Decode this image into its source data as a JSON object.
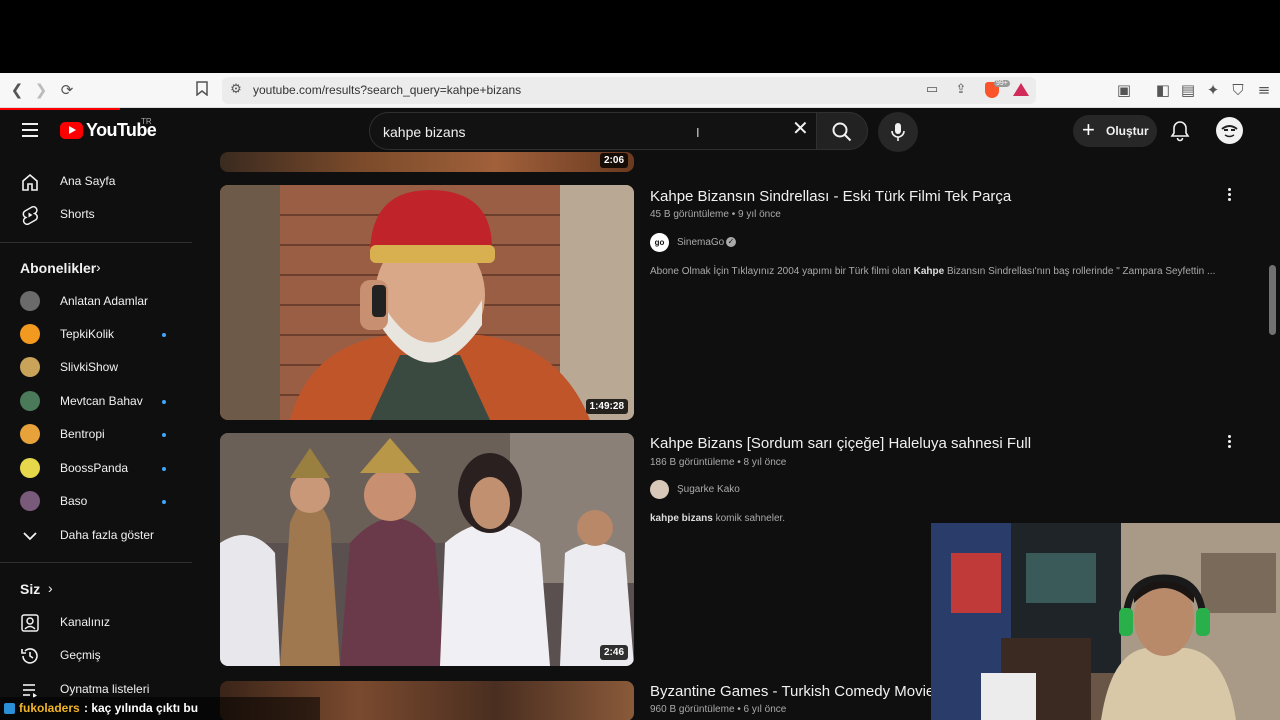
{
  "browser": {
    "url": "youtube.com/results?search_query=kahpe+bizans",
    "brave_badge": "99+"
  },
  "masthead": {
    "logo_text": "YouTube",
    "logo_region": "TR",
    "search_query": "kahpe bizans",
    "create_label": "Oluştur"
  },
  "sidebar": {
    "main": [
      {
        "label": "Ana Sayfa",
        "icon": "home-icon"
      },
      {
        "label": "Shorts",
        "icon": "shorts-icon"
      }
    ],
    "subscriptions_header": "Abonelikler",
    "subscriptions": [
      {
        "label": "Anlatan Adamlar",
        "dot": false,
        "color": "#6b6b6b"
      },
      {
        "label": "TepkiKolik",
        "dot": true,
        "color": "#f29a1f"
      },
      {
        "label": "SlivkiShow",
        "dot": false,
        "color": "#c9a35a"
      },
      {
        "label": "Mevtcan Bahav",
        "dot": true,
        "color": "#4a7a5a"
      },
      {
        "label": "Bentropi",
        "dot": true,
        "color": "#e8a23a"
      },
      {
        "label": "BoossPanda",
        "dot": true,
        "color": "#e6d84a"
      },
      {
        "label": "Baso",
        "dot": true,
        "color": "#7a5a7a"
      }
    ],
    "show_more": "Daha fazla göster",
    "you_header": "Siz",
    "you_items": [
      {
        "label": "Kanalınız",
        "icon": "your-channel-icon"
      },
      {
        "label": "Geçmiş",
        "icon": "history-icon"
      },
      {
        "label": "Oynatma listeleri",
        "icon": "playlists-icon"
      }
    ]
  },
  "results": [
    {
      "duration": "2:06"
    },
    {
      "title": "Kahpe Bizansın Sindrellası - Eski Türk Filmi Tek Parça",
      "meta": "45 B görüntüleme • 9 yıl önce",
      "channel": "SinemaGo",
      "verified": true,
      "desc_pre": "Abone Olmak İçin Tıklayınız 2004 yapımı bir Türk filmi olan ",
      "desc_bold": "Kahpe",
      "desc_post": " Bizansın Sindrellası'nın baş rollerinde \" Zampara Seyfettin ...",
      "duration": "1:49:28"
    },
    {
      "title": "Kahpe Bizans [Sordum sarı çiçeğe] Haleluya sahnesi Full",
      "meta": "186 B görüntüleme • 8 yıl önce",
      "channel": "Şugarke Kako",
      "desc_bold": "kahpe bizans",
      "desc_post": " komik sahneler.",
      "duration": "2:46"
    },
    {
      "title": "Byzantine Games - Turkish Comedy Movie",
      "meta": "960 B görüntüleme • 6 yıl önce"
    }
  ],
  "chat": {
    "user": "fukoladers",
    "message": ": kaç yılında çıktı bu"
  },
  "colors": {
    "youtube_red": "#ff0000",
    "background": "#0f0f0f",
    "accent_blue": "#3ea6ff"
  }
}
